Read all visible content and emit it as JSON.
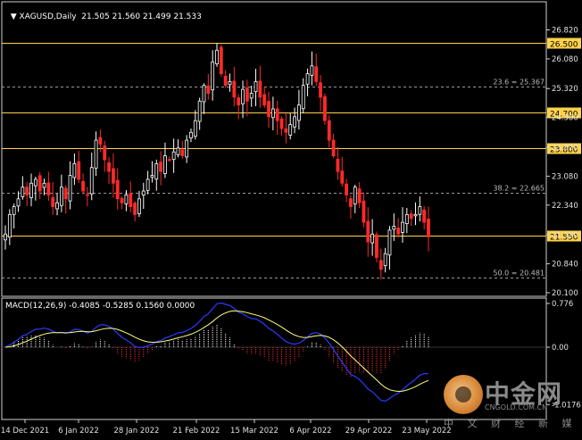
{
  "window": {
    "symbol_timeframe": "XAGUSD,Daily",
    "ohlc": "21.505 21.560 21.499 21.533",
    "icon": "chart-dropdown-triangle-icon"
  },
  "macd_panel": {
    "label": "MACD(12,26,9) -0.4085 -0.5285 0.1560 0.0000"
  },
  "watermark": {
    "brand": "中金网",
    "url": "CNGOLD.COM.CN",
    "tagline": "中 文 财 经 新 媒 体",
    "icon": "cngold-logo-icon"
  },
  "colors": {
    "background": "#000000",
    "bull": "#ffffff",
    "bear": "#ff2a2a",
    "level_line": "#ffd24a",
    "fib_line": "#9a9a9a",
    "macd_line": "#2b3cff",
    "signal_line": "#ffff80"
  },
  "chart_data": [
    {
      "type": "candlestick",
      "series": "XAGUSD Daily",
      "ylim": [
        20.1,
        26.9
      ],
      "y_ticks": [
        "26.820",
        "26.080",
        "25.320",
        "24.580",
        "23.820",
        "23.080",
        "22.340",
        "21.580",
        "20.840",
        "20.100"
      ],
      "x_ticks": [
        "14 Dec 2021",
        "6 Jan 2022",
        "28 Jan 2022",
        "21 Feb 2022",
        "15 Mar 2022",
        "6 Apr 2022",
        "29 Apr 2022",
        "23 May 2022"
      ],
      "horizontal_levels": [
        "26.500",
        "24.700",
        "23.800",
        "21.550"
      ],
      "fib_levels": [
        {
          "label": "23.6 = 25.367",
          "value": 25.367
        },
        {
          "label": "38.2 = 22.665",
          "value": 22.665
        },
        {
          "label": "50.0 = 20.481",
          "value": 20.481
        }
      ],
      "closes": [
        21.6,
        22.1,
        22.3,
        22.5,
        22.8,
        22.6,
        22.9,
        23.0,
        22.7,
        22.9,
        22.6,
        22.3,
        22.4,
        22.8,
        22.5,
        23.1,
        23.4,
        23.0,
        22.7,
        22.6,
        23.3,
        24.0,
        23.9,
        23.5,
        23.2,
        22.9,
        22.5,
        22.4,
        22.6,
        22.3,
        22.1,
        22.5,
        22.7,
        23.0,
        23.1,
        23.4,
        23.2,
        23.6,
        23.5,
        23.7,
        23.8,
        23.6,
        24.0,
        24.2,
        24.5,
        25.0,
        25.4,
        25.2,
        26.0,
        26.3,
        25.7,
        25.4,
        25.5,
        25.1,
        24.9,
        25.3,
        25.0,
        25.2,
        25.5,
        25.1,
        24.9,
        24.6,
        24.8,
        24.5,
        24.3,
        24.2,
        24.4,
        24.6,
        24.9,
        25.4,
        25.7,
        25.9,
        25.5,
        25.1,
        24.5,
        24.0,
        23.6,
        23.2,
        22.9,
        22.6,
        22.3,
        22.8,
        22.4,
        21.9,
        21.4,
        21.6,
        21.0,
        20.7,
        21.1,
        21.7,
        21.8,
        21.6,
        21.9,
        22.1,
        22.0,
        22.1,
        22.3,
        21.9,
        21.53
      ]
    },
    {
      "type": "macd",
      "ylim": [
        -1.25,
        0.776
      ],
      "y_ticks": [
        "0.776",
        "0.00",
        "-1.0176"
      ],
      "params": "12,26,9",
      "histogram_note": "derived from price series",
      "macd_last": -0.4085,
      "signal_last": -0.5285,
      "hist_last": 0.156
    }
  ]
}
